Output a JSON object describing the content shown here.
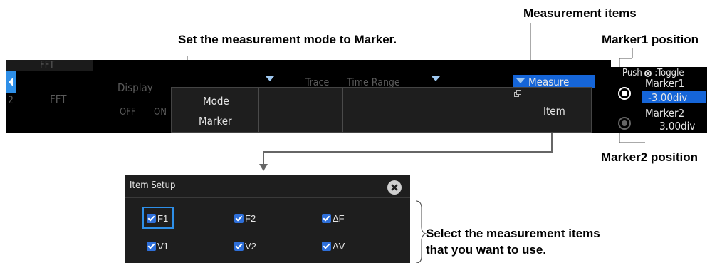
{
  "callouts": {
    "measurement_items": "Measurement items",
    "set_mode": "Set the measurement mode to Marker.",
    "marker1_position": "Marker1 position",
    "marker2_position": "Marker2 position",
    "select_line1": "Select the measurement items",
    "select_line2": "that you want to use."
  },
  "top_bar": {
    "header_label": "FFT",
    "channel_num": "2",
    "source_label": "FFT",
    "display_label": "Display",
    "display_off": "OFF",
    "display_on": "ON",
    "trace_label": "Trace",
    "time_range_label": "Time Range",
    "measure_label": "Measure"
  },
  "softkey_menu": {
    "mode_label": "Mode",
    "mode_value": "Marker",
    "item_label": "Item"
  },
  "marker_panel": {
    "toggle_hint_prefix": "Push",
    "toggle_hint_suffix": ":Toggle",
    "marker1_label": "Marker1",
    "marker1_value": "-3.00div",
    "marker2_label": "Marker2",
    "marker2_value": "3.00div"
  },
  "item_setup": {
    "title": "Item Setup",
    "items": [
      {
        "label": "F1",
        "checked": true
      },
      {
        "label": "F2",
        "checked": true
      },
      {
        "label": "ΔF",
        "checked": true
      },
      {
        "label": "V1",
        "checked": true
      },
      {
        "label": "V2",
        "checked": true
      },
      {
        "label": "ΔV",
        "checked": true
      }
    ]
  },
  "colors": {
    "accent_blue": "#2e8fe8",
    "highlight_blue": "#1565d8",
    "checkbox_blue": "#2e6fd9",
    "panel_dark": "#1e1e1e"
  }
}
